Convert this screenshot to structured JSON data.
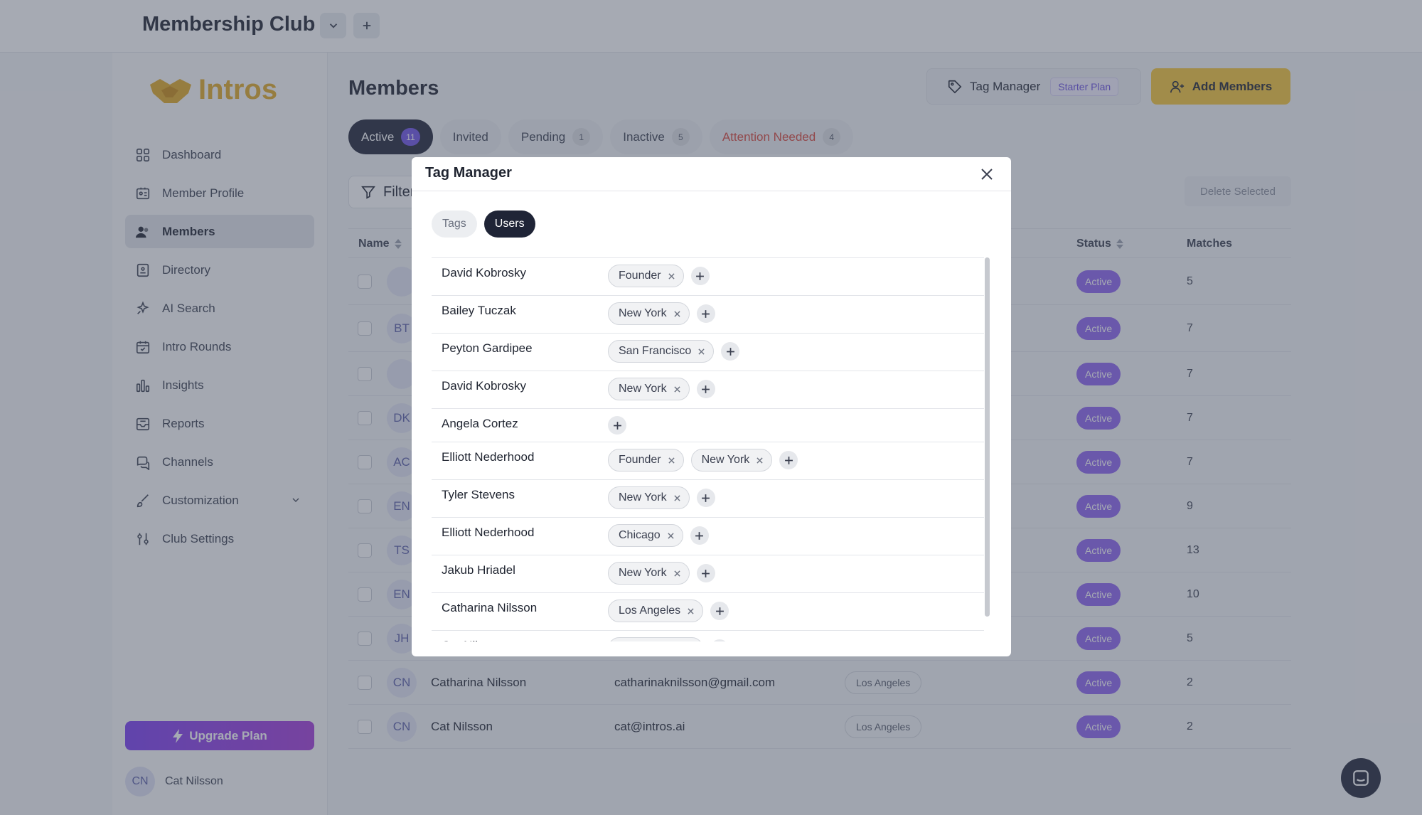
{
  "app": {
    "club_title": "Membership Club",
    "logo_text": "Intros"
  },
  "sidebar": {
    "items": [
      {
        "label": "Dashboard",
        "icon": "dashboard-icon"
      },
      {
        "label": "Member Profile",
        "icon": "id-card-icon"
      },
      {
        "label": "Members",
        "icon": "users-icon",
        "active": true
      },
      {
        "label": "Directory",
        "icon": "book-icon"
      },
      {
        "label": "AI Search",
        "icon": "sparkle-icon"
      },
      {
        "label": "Intro Rounds",
        "icon": "calendar-icon"
      },
      {
        "label": "Insights",
        "icon": "bar-chart-icon"
      },
      {
        "label": "Reports",
        "icon": "inbox-icon"
      },
      {
        "label": "Channels",
        "icon": "chat-icon"
      },
      {
        "label": "Customization",
        "icon": "brush-icon"
      },
      {
        "label": "Club Settings",
        "icon": "sliders-icon"
      }
    ],
    "upgrade_label": "Upgrade Plan",
    "user_initials": "CN",
    "user_name": "Cat Nilsson"
  },
  "main": {
    "title": "Members",
    "tag_manager_label": "Tag Manager",
    "plan_badge": "Starter Plan",
    "add_members_label": "Add Members",
    "filter_label": "Filter",
    "delete_selected_label": "Delete Selected",
    "tabs": [
      {
        "label": "Active",
        "count": "11"
      },
      {
        "label": "Invited",
        "count": ""
      },
      {
        "label": "Pending",
        "count": "1"
      },
      {
        "label": "Inactive",
        "count": "5"
      },
      {
        "label": "Attention Needed",
        "count": "4"
      }
    ],
    "columns": {
      "name": "Name",
      "status": "Status",
      "matches": "Matches"
    },
    "rows": [
      {
        "initials": "",
        "name": "",
        "email": "",
        "location": "",
        "status": "Active",
        "matches": "5"
      },
      {
        "initials": "BT",
        "name": "",
        "email": "",
        "location": "",
        "status": "Active",
        "matches": "7"
      },
      {
        "initials": "",
        "name": "",
        "email": "",
        "location": "",
        "status": "Active",
        "matches": "7"
      },
      {
        "initials": "DK",
        "name": "",
        "email": "",
        "location": "",
        "status": "Active",
        "matches": "7"
      },
      {
        "initials": "AC",
        "name": "",
        "email": "",
        "location": "",
        "status": "Active",
        "matches": "7"
      },
      {
        "initials": "EN",
        "name": "",
        "email": "",
        "location": "",
        "status": "Active",
        "matches": "9"
      },
      {
        "initials": "TS",
        "name": "",
        "email": "",
        "location": "",
        "status": "Active",
        "matches": "13"
      },
      {
        "initials": "EN",
        "name": "",
        "email": "",
        "location": "",
        "status": "Active",
        "matches": "10"
      },
      {
        "initials": "JH",
        "name": "",
        "email": "",
        "location": "",
        "status": "Active",
        "matches": "5"
      },
      {
        "initials": "CN",
        "name": "Catharina Nilsson",
        "email": "catharinaknilsson@gmail.com",
        "location": "Los Angeles",
        "status": "Active",
        "matches": "2"
      },
      {
        "initials": "CN",
        "name": "Cat Nilsson",
        "email": "cat@intros.ai",
        "location": "Los Angeles",
        "status": "Active",
        "matches": "2"
      }
    ]
  },
  "modal": {
    "title": "Tag Manager",
    "segments": [
      "Tags",
      "Users"
    ],
    "active_segment": "Users",
    "users": [
      {
        "name": "David Kobrosky",
        "tags": [
          "Founder"
        ]
      },
      {
        "name": "Bailey Tuczak",
        "tags": [
          "New York"
        ]
      },
      {
        "name": "Peyton Gardipee",
        "tags": [
          "San Francisco"
        ]
      },
      {
        "name": "David Kobrosky",
        "tags": [
          "New York"
        ]
      },
      {
        "name": "Angela Cortez",
        "tags": []
      },
      {
        "name": "Elliott Nederhood",
        "tags": [
          "Founder",
          "New York"
        ]
      },
      {
        "name": "Tyler Stevens",
        "tags": [
          "New York"
        ]
      },
      {
        "name": "Elliott Nederhood",
        "tags": [
          "Chicago"
        ]
      },
      {
        "name": "Jakub Hriadel",
        "tags": [
          "New York"
        ]
      },
      {
        "name": "Catharina Nilsson",
        "tags": [
          "Los Angeles"
        ]
      },
      {
        "name": "Cat Nilsson",
        "tags": [
          "Los Angeles"
        ]
      }
    ]
  },
  "colors": {
    "accent_purple": "#6e52e6",
    "status_active": "#8c62f0",
    "add_button": "#f5c637",
    "logo": "#e0a923",
    "warning": "#d8453a"
  }
}
